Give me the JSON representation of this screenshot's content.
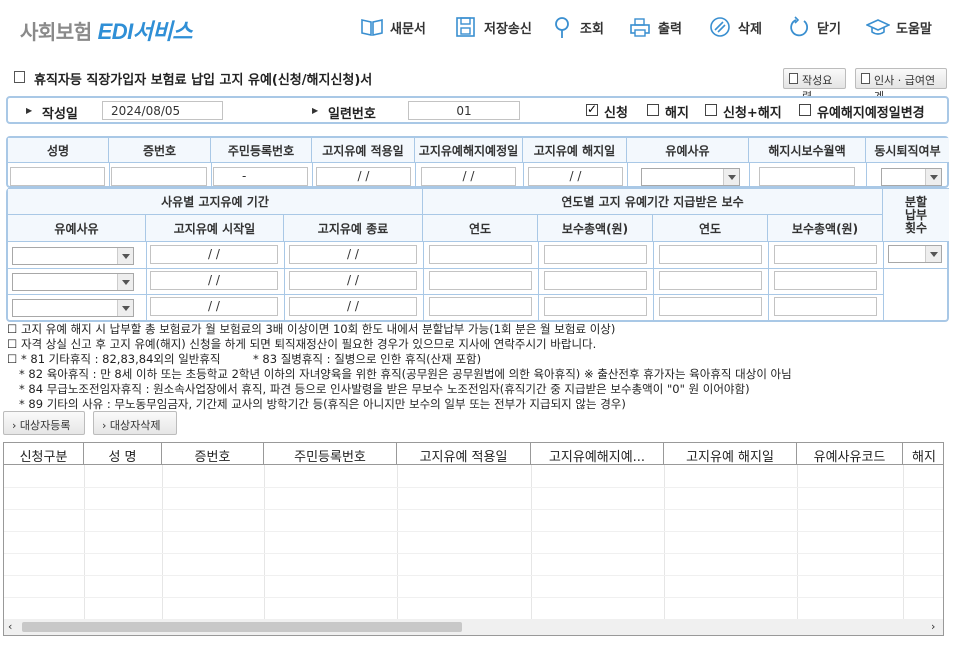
{
  "app": {
    "logo_part1": "사회보험",
    "logo_part2": "EDI서비스"
  },
  "nav": [
    {
      "label": "새문서",
      "icon": "book-icon"
    },
    {
      "label": "저장송신",
      "icon": "save-icon"
    },
    {
      "label": "조회",
      "icon": "search-pin-icon"
    },
    {
      "label": "출력",
      "icon": "printer-icon"
    },
    {
      "label": "삭제",
      "icon": "delete-icon"
    },
    {
      "label": "닫기",
      "icon": "close-icon"
    },
    {
      "label": "도움말",
      "icon": "help-cap-icon"
    }
  ],
  "page": {
    "title": "휴직자등 직장가입자 보험료 납입 고지 유예(신청/해지신청)서",
    "guide_button": "작성요령",
    "link_button": "인사 · 급여연계"
  },
  "info": {
    "date_label": "작성일",
    "date_value": "2024/08/05",
    "serial_label": "일련번호",
    "serial_value": "01",
    "options": [
      {
        "label": "신청",
        "checked": true
      },
      {
        "label": "해지",
        "checked": false
      },
      {
        "label": "신청+해지",
        "checked": false
      },
      {
        "label": "유예해지예정일변경",
        "checked": false
      }
    ]
  },
  "grid1": {
    "headers": [
      "성명",
      "증번호",
      "주민등록번호",
      "고지유예 적용일",
      "고지유예해지예정일",
      "고지유예 해지일",
      "유예사유",
      "해지시보수월액",
      "동시퇴직여부"
    ],
    "rrn_value": "-",
    "date_value": "/ /"
  },
  "grid2": {
    "period_header": "사유별 고지유예 기간",
    "pay_header": "연도별 고지 유예기간 지급받은 보수",
    "installment_header": "분할납부횟수",
    "sub_headers": [
      "유예사유",
      "고지유예 시작일",
      "고지유예 종료",
      "연도",
      "보수총액(원)",
      "연도",
      "보수총액(원)"
    ],
    "date_value": "/ /"
  },
  "notes": [
    "고지 유예 해지 시 납부할 총 보험료가 월 보험료의 3배 이상이면 10회 한도 내에서 분할납부 가능(1회 분은 월 보험료 이상)",
    "자격 상실 신고 후 고지 유예(해지) 신청을 하게 되면 퇴직재정산이 필요한 경우가 있으므로 지사에 연락주시기 바랍니다.",
    "* 81 기타휴직 : 82,83,84외의 일반휴직",
    "* 83 질병휴직 : 질병으로 인한 휴직(산재 포함)",
    "* 82 육아휴직 : 만 8세 이하 또는 초등학교 2학년 이하의 자녀양육을 위한 휴직(공무원은 공무원법에 의한 육아휴직) ※ 출산전후 휴가자는 육아휴직 대상이 아님",
    "* 84 무급노조전임자휴직 : 원소속사업장에서 휴직, 파견 등으로 인사발령을 받은 무보수 노조전임자(휴직기간 중 지급받은 보수총액이 \"0\" 원 이어야함)",
    "* 89 기타의 사유 : 무노동무임금자, 기간제 교사의 방학기간 등(휴직은 아니지만 보수의 일부 또는 전부가 지급되지 않는 경우)"
  ],
  "actions": {
    "register": "대상자등록",
    "delete": "대상자삭제"
  },
  "table": {
    "columns": [
      "신청구분",
      "성 명",
      "증번호",
      "주민등록번호",
      "고지유예 적용일",
      "고지유예해지예...",
      "고지유예 해지일",
      "유예사유코드",
      "해지"
    ]
  },
  "colors": {
    "accent": "#2f8fd6",
    "border": "#a9c8e6",
    "header_bg": "#f3f8fd"
  }
}
